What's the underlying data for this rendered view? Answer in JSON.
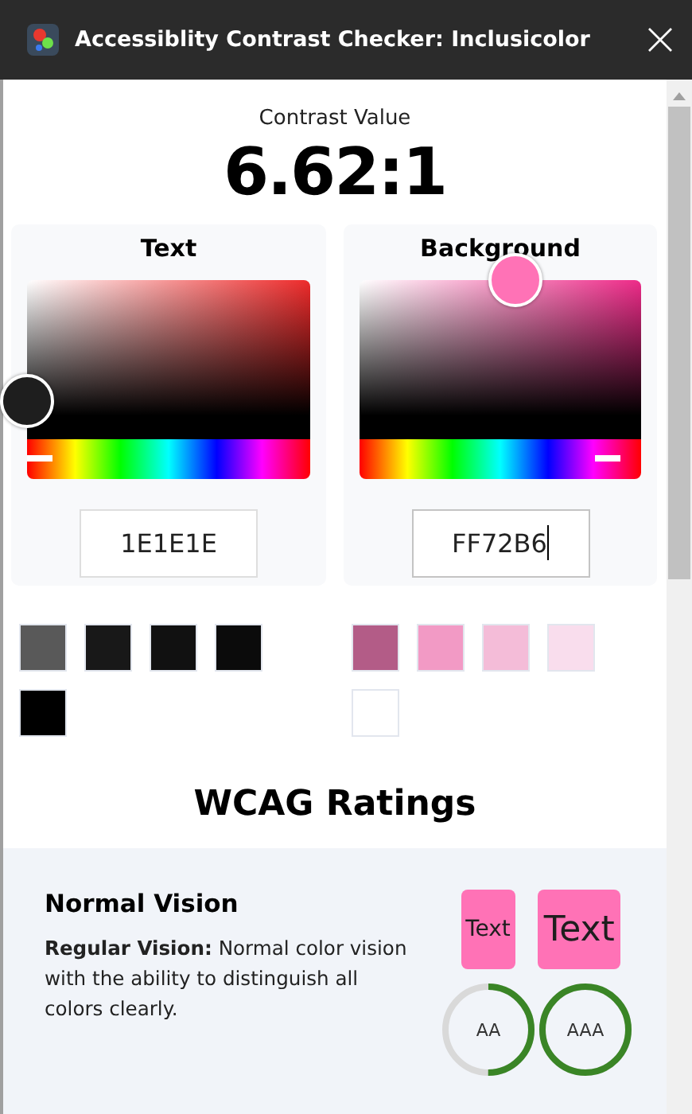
{
  "window": {
    "title": "Accessiblity Contrast Checker: Inclusicolor"
  },
  "contrast": {
    "label": "Contrast Value",
    "value": "6.62:1"
  },
  "pickers": [
    {
      "title": "Text",
      "value": "1E1E1E",
      "level": 0,
      "focused": false,
      "swatches": [
        {
          "color": "#595959"
        },
        {
          "color": "#181818"
        },
        {
          "color": "#111111"
        },
        {
          "color": "#0b0b0b"
        },
        {
          "color": "#000000"
        }
      ]
    },
    {
      "title": "Background",
      "value": "FF72B6",
      "level": 0.92,
      "focused": true,
      "swatches": [
        {
          "color": "#b35c87"
        },
        {
          "color": "#f29ac5"
        },
        {
          "color": "#f4bcd8"
        },
        {
          "color": "#f9dded"
        },
        {
          "color": "#ffffff"
        }
      ]
    }
  ],
  "wcag": {
    "title": "WCAG Ratings",
    "cards": [
      {
        "title": "Normal Vision",
        "description": "**Regular Vision:** Normal color vision with the ability to distinguish all colors clearly.",
        "samples": [
          {
            "label": "Text",
            "kind": "normal"
          },
          {
            "label": "Text",
            "kind": "large"
          }
        ],
        "ratings": [
          {
            "label": "AA",
            "level": 0.5
          },
          {
            "label": "AAA",
            "level": 1
          }
        ]
      }
    ]
  }
}
